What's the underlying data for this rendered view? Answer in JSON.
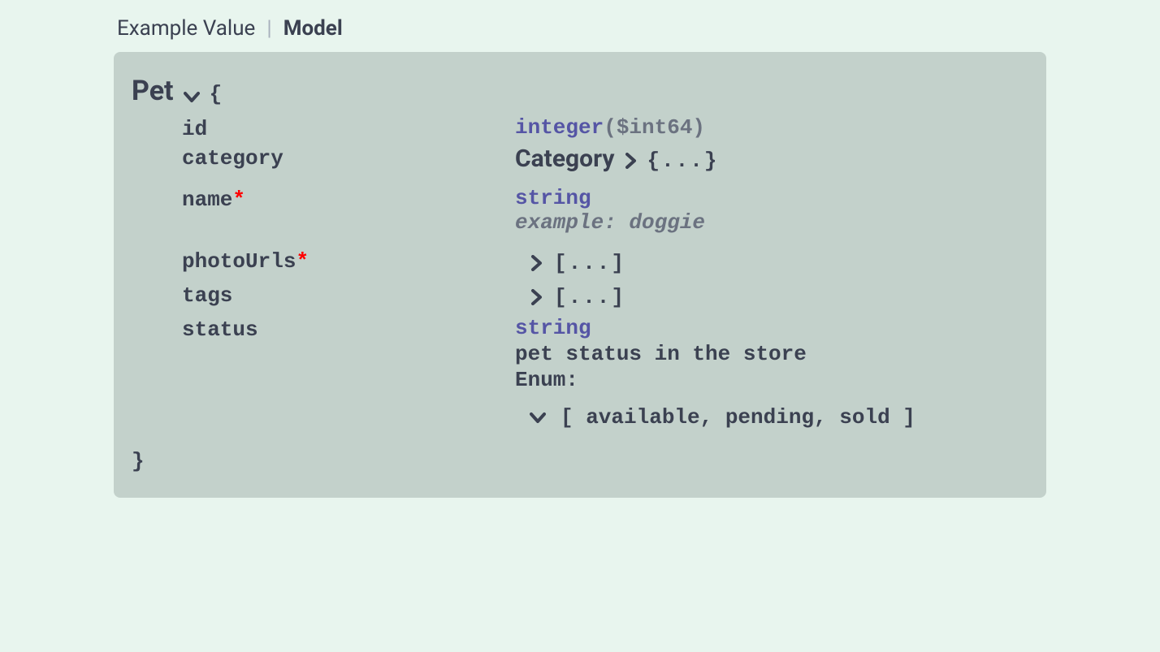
{
  "tabs": {
    "example_value": "Example Value",
    "model": "Model"
  },
  "model": {
    "title": "Pet",
    "open_brace": "{",
    "close_brace": "}",
    "collapsed_obj": "{...}",
    "collapsed_arr": "[...]",
    "properties": {
      "id": {
        "name": "id",
        "type": "integer",
        "format": "($int64)"
      },
      "category": {
        "name": "category",
        "ref_title": "Category"
      },
      "name": {
        "name": "name",
        "type": "string",
        "example_label": "example: doggie"
      },
      "photoUrls": {
        "name": "photoUrls"
      },
      "tags": {
        "name": "tags"
      },
      "status": {
        "name": "status",
        "type": "string",
        "description": "pet status in the store",
        "enum_label": "Enum:",
        "enum_values": "[ available, pending, sold ]"
      }
    }
  }
}
